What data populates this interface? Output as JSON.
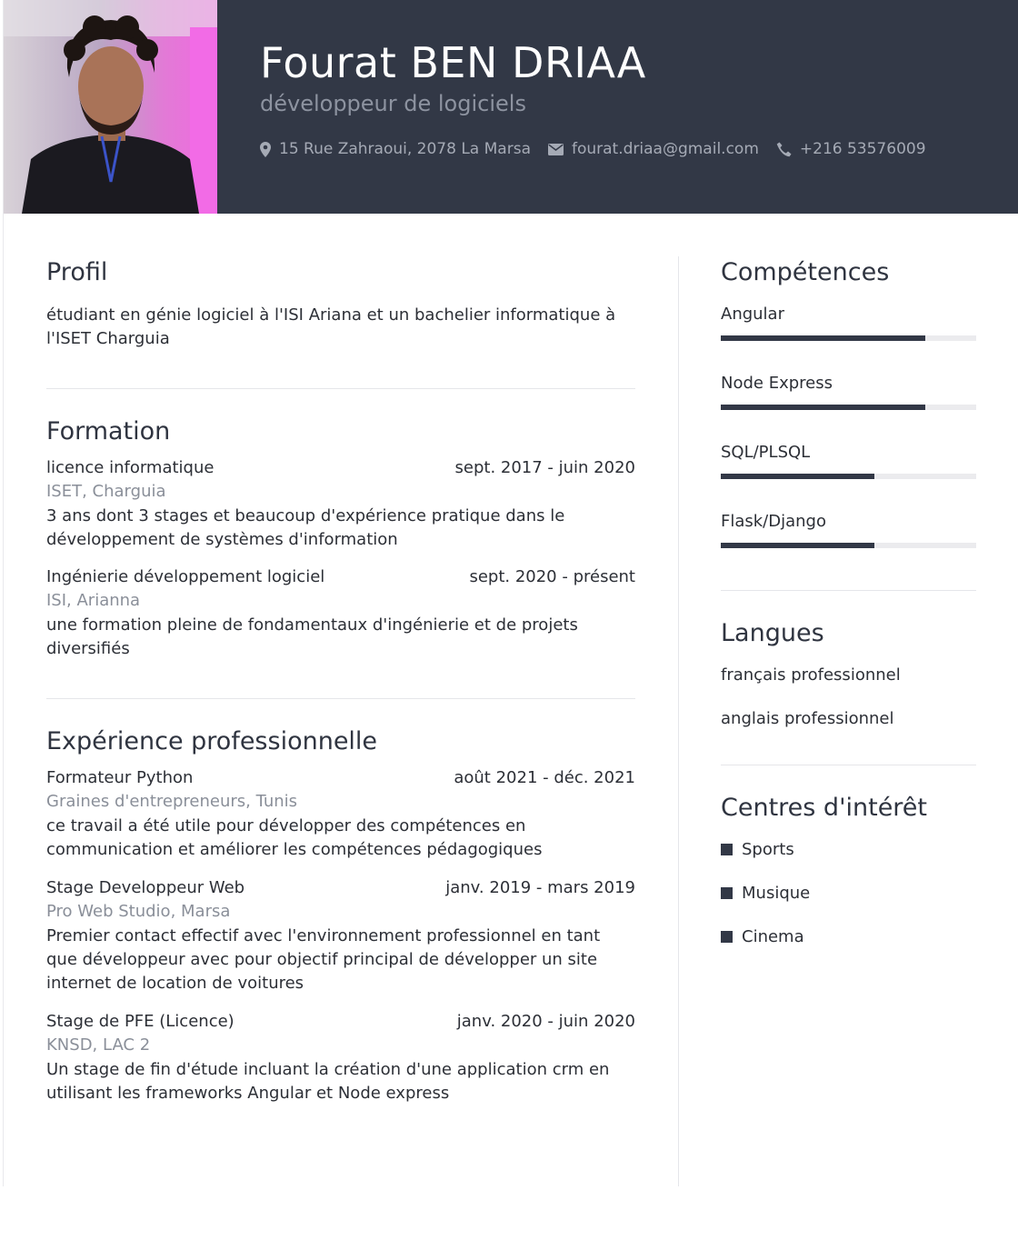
{
  "header": {
    "name": "Fourat BEN DRIAA",
    "title": "développeur de logiciels",
    "contacts": [
      {
        "icon": "map-marker-icon",
        "text": "15 Rue Zahraoui, 2078 La Marsa"
      },
      {
        "icon": "envelope-icon",
        "text": "fourat.driaa@gmail.com"
      },
      {
        "icon": "phone-icon",
        "text": "+216 53576009"
      }
    ]
  },
  "profile": {
    "heading": "Profil",
    "text": "étudiant en génie logiciel à l'ISI Ariana et un bachelier informatique à l'ISET Charguia"
  },
  "education": {
    "heading": "Formation",
    "entries": [
      {
        "title": "licence informatique",
        "dates": "sept. 2017 - juin 2020",
        "org": "ISET, Charguia",
        "desc": "3 ans dont 3 stages et beaucoup d'expérience pratique dans le développement de systèmes d'information"
      },
      {
        "title": "Ingénierie développement logiciel",
        "dates": "sept. 2020 - présent",
        "org": "ISI, Arianna",
        "desc": "une formation pleine de fondamentaux d'ingénierie et de projets diversifiés"
      }
    ]
  },
  "experience": {
    "heading": "Expérience professionnelle",
    "entries": [
      {
        "title": "Formateur Python",
        "dates": "août 2021 - déc. 2021",
        "org": "Graines d'entrepreneurs, Tunis",
        "desc": "ce travail a été utile pour développer des compétences en communication et améliorer les compétences pédagogiques"
      },
      {
        "title": "Stage Developpeur Web",
        "dates": "janv. 2019 - mars 2019",
        "org": "Pro Web Studio, Marsa",
        "desc": "Premier contact effectif avec l'environnement professionnel en tant que développeur avec pour objectif principal de développer un site internet de location de voitures"
      },
      {
        "title": "Stage de PFE (Licence)",
        "dates": "janv. 2020 - juin 2020",
        "org": "KNSD, LAC 2",
        "desc": "Un stage de fin d'étude incluant la création d'une application crm en utilisant les frameworks Angular et Node express"
      }
    ]
  },
  "skills": {
    "heading": "Compétences",
    "items": [
      {
        "label": "Angular",
        "level": 0.8
      },
      {
        "label": "Node Express",
        "level": 0.8
      },
      {
        "label": "SQL/PLSQL",
        "level": 0.6
      },
      {
        "label": "Flask/Django",
        "level": 0.6
      }
    ]
  },
  "languages": {
    "heading": "Langues",
    "items": [
      "français professionnel",
      "anglais professionnel"
    ]
  },
  "interests": {
    "heading": "Centres d'intérêt",
    "items": [
      "Sports",
      "Musique",
      "Cinema"
    ]
  },
  "colors": {
    "header_bg": "#323846",
    "accent": "#323846",
    "muted": "#8a8f99"
  }
}
